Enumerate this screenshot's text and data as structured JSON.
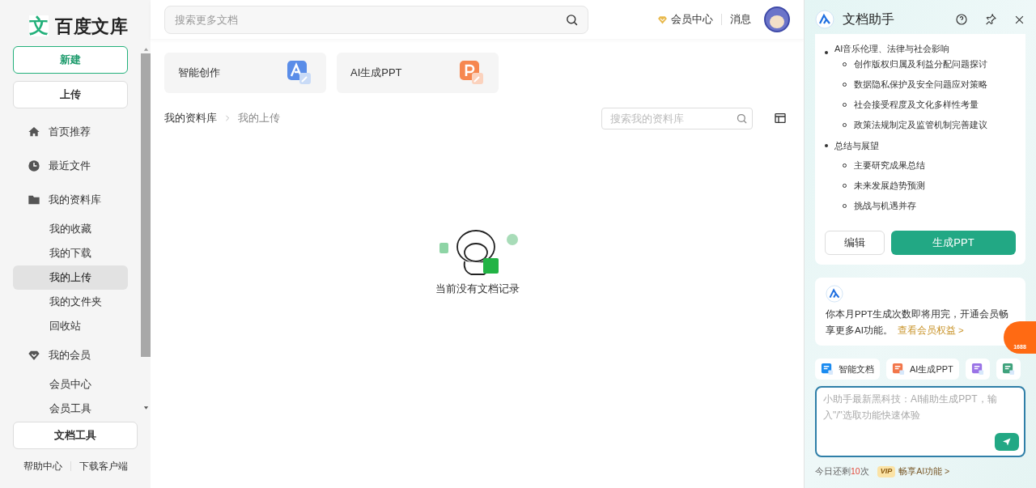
{
  "logo": {
    "mark": "文",
    "text": "百度文库"
  },
  "sidebar": {
    "new_button": "新建",
    "upload_button": "上传",
    "nav": [
      {
        "label": "首页推荐",
        "kind": "home",
        "selected": false
      },
      {
        "label": "最近文件",
        "kind": "recent",
        "selected": false
      },
      {
        "label": "我的资料库",
        "kind": "library",
        "selected": false,
        "children": [
          {
            "label": "我的收藏",
            "selected": false
          },
          {
            "label": "我的下载",
            "selected": false
          },
          {
            "label": "我的上传",
            "selected": true
          },
          {
            "label": "我的文件夹",
            "selected": false
          },
          {
            "label": "回收站",
            "selected": false
          }
        ]
      },
      {
        "label": "我的会员",
        "kind": "member",
        "selected": false,
        "children": [
          {
            "label": "会员中心",
            "selected": false
          },
          {
            "label": "会员工具",
            "selected": false
          }
        ]
      }
    ],
    "tools_button": "文档工具",
    "footer_links": [
      "帮助中心",
      "下载客户端"
    ]
  },
  "header": {
    "search": {
      "placeholder": "搜索更多文档"
    },
    "vip_link": "会员中心",
    "messages": "消息"
  },
  "tool_cards": [
    {
      "label": "智能创作",
      "kind": "write"
    },
    {
      "label": "AI生成PPT",
      "kind": "ppt"
    }
  ],
  "breadcrumb": [
    {
      "label": "我的资料库"
    },
    {
      "label": "我的上传"
    }
  ],
  "library_search": {
    "placeholder": "搜索我的资料库"
  },
  "empty_state": "当前没有文档记录",
  "assistant": {
    "title": "文档助手",
    "outline": [
      {
        "text": "AI音乐伦理、法律与社会影响",
        "children": [
          {
            "text": "创作版权归属及利益分配问题探讨"
          },
          {
            "text": "数据隐私保护及安全问题应对策略"
          },
          {
            "text": "社会接受程度及文化多样性考量"
          },
          {
            "text": "政策法规制定及监管机制完善建议"
          }
        ]
      },
      {
        "text": "总结与展望",
        "children": [
          {
            "text": "主要研究成果总结"
          },
          {
            "text": "未来发展趋势预测"
          },
          {
            "text": "挑战与机遇并存"
          }
        ]
      }
    ],
    "edit_button": "编辑",
    "generate_button": "生成PPT",
    "notice": {
      "text": "你本月PPT生成次数即将用完，开通会员畅享更多AI功能。",
      "link": "查看会员权益 >"
    },
    "quick_tools": [
      {
        "label": "智能文档",
        "kind": "doc"
      },
      {
        "label": "AI生成PPT",
        "kind": "ppt"
      },
      {
        "kind": "note"
      },
      {
        "kind": "mind"
      }
    ],
    "input": {
      "placeholder": "小助手最新黑科技：AI辅助生成PPT，输入\"/\"选取功能快速体验"
    },
    "quota": {
      "prefix": "今日还剩",
      "count": "10",
      "suffix": "次"
    },
    "vip": {
      "badge": "VIP",
      "link": "畅享AI功能 >"
    }
  },
  "side_badge": "1688"
}
